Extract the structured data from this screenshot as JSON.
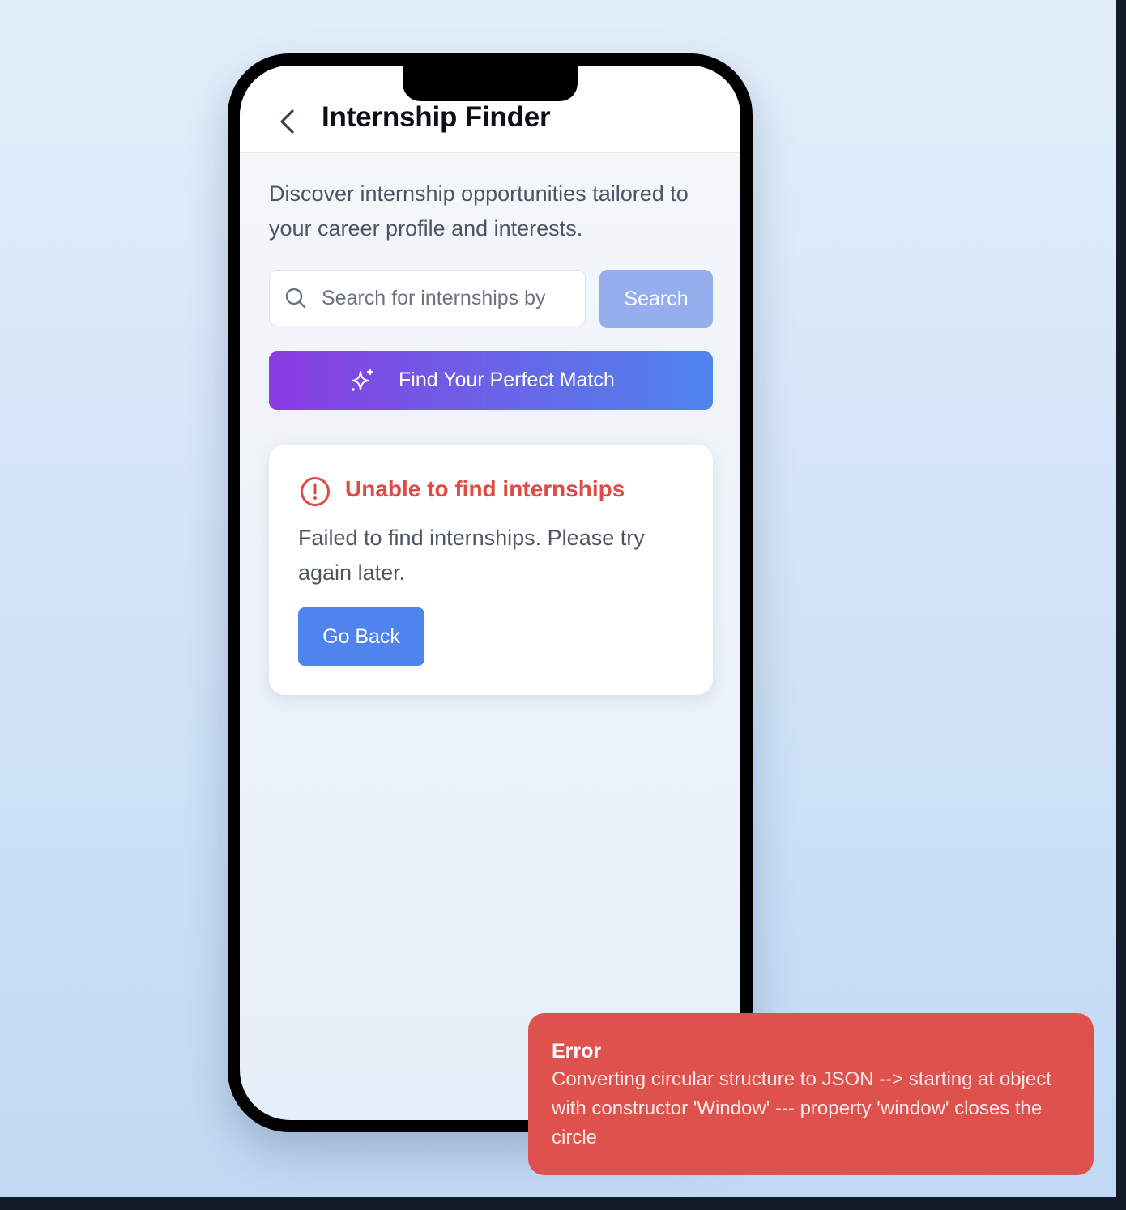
{
  "app": {
    "title": "Internship Finder",
    "intro": "Discover internship opportunities tailored to your career profile and interests."
  },
  "search": {
    "placeholder": "Search for internships by",
    "value": "",
    "button_label": "Search"
  },
  "match_button": {
    "label": "Find Your Perfect Match",
    "icon": "sparkles-icon"
  },
  "error_card": {
    "icon": "alert-circle-icon",
    "title": "Unable to find internships",
    "message": "Failed to find internships. Please try again later.",
    "button_label": "Go Back"
  },
  "toast": {
    "title": "Error",
    "message": "Converting circular structure to JSON --> starting at object with constructor 'Window' --- property 'window' closes the circle"
  },
  "colors": {
    "error_red": "#dd4b46",
    "toast_bg": "#df514c",
    "primary_blue": "#4e84ec",
    "search_button_disabled": "#94aeee",
    "gradient_start": "#8a3be3",
    "gradient_end": "#4f84ec"
  }
}
